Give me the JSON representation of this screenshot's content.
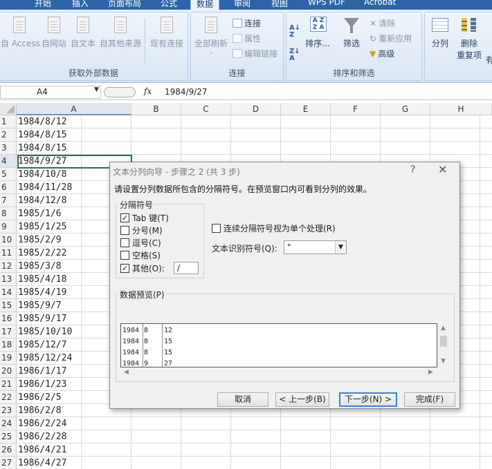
{
  "ribbon": {
    "tabs": [
      "开始",
      "插入",
      "页面布局",
      "公式",
      "数据",
      "审阅",
      "视图",
      "WPS PDF",
      "Acrobat"
    ],
    "active_tab": "数据",
    "get_external": {
      "label": "获取外部数据",
      "access": "自 Access",
      "web": "自网站",
      "text": "自文本",
      "other": "自其他来源",
      "existing": "现有连接"
    },
    "connections": {
      "label": "连接",
      "refresh_all": "全部刷新",
      "connect": "连接",
      "properties": "属性",
      "edit_links": "编辑链接"
    },
    "sort_filter": {
      "label": "排序和筛选",
      "sort": "排序...",
      "filter": "筛选",
      "clear": "清除",
      "reapply": "重新应用",
      "advanced": "高级"
    },
    "data_tools": {
      "split": "分列",
      "remove_dup": "删除",
      "remove_dup2": "重复项",
      "more": "有"
    }
  },
  "formula_bar": {
    "name_box": "A4",
    "fx": "fx",
    "formula": "1984/9/27"
  },
  "columns": [
    "A",
    "B",
    "C",
    "D",
    "E",
    "F",
    "G",
    "H"
  ],
  "rows": [
    {
      "num": "1",
      "a": "1984/8/12"
    },
    {
      "num": "2",
      "a": "1984/8/15"
    },
    {
      "num": "3",
      "a": "1984/8/15"
    },
    {
      "num": "4",
      "a": "1984/9/27"
    },
    {
      "num": "5",
      "a": "1984/10/8"
    },
    {
      "num": "6",
      "a": "1984/11/28"
    },
    {
      "num": "7",
      "a": "1984/12/8"
    },
    {
      "num": "8",
      "a": "1985/1/6"
    },
    {
      "num": "9",
      "a": "1985/1/25"
    },
    {
      "num": "10",
      "a": "1985/2/9"
    },
    {
      "num": "11",
      "a": "1985/2/22"
    },
    {
      "num": "12",
      "a": "1985/3/8"
    },
    {
      "num": "13",
      "a": "1985/4/18"
    },
    {
      "num": "14",
      "a": "1985/4/19"
    },
    {
      "num": "15",
      "a": "1985/9/7"
    },
    {
      "num": "16",
      "a": "1985/9/17"
    },
    {
      "num": "17",
      "a": "1985/10/10"
    },
    {
      "num": "18",
      "a": "1985/12/7"
    },
    {
      "num": "19",
      "a": "1985/12/24"
    },
    {
      "num": "20",
      "a": "1986/1/17"
    },
    {
      "num": "21",
      "a": "1986/1/23"
    },
    {
      "num": "22",
      "a": "1986/2/5"
    },
    {
      "num": "23",
      "a": "1986/2/8"
    },
    {
      "num": "24",
      "a": "1986/2/24"
    },
    {
      "num": "25",
      "a": "1986/2/28"
    },
    {
      "num": "26",
      "a": "1986/4/21"
    },
    {
      "num": "27",
      "a": "1986/4/27"
    }
  ],
  "dialog": {
    "title": "文本分列向导 - 步骤之 2 (共 3 步)",
    "help": "?",
    "close": "✕",
    "description": "请设置分列数据所包含的分隔符号。在预览窗口内可看到分列的效果。",
    "delimiters_legend": "分隔符号",
    "tab": {
      "label": "Tab 键(T)",
      "checked": true
    },
    "semicolon": {
      "label": "分号(M)",
      "checked": false
    },
    "comma": {
      "label": "逗号(C)",
      "checked": false
    },
    "space": {
      "label": "空格(S)",
      "checked": false
    },
    "other": {
      "label": "其他(O):",
      "checked": true,
      "value": "/"
    },
    "consecutive": {
      "label": "连续分隔符号视为单个处理(R)",
      "checked": false
    },
    "qualifier_label": "文本识别符号(Q):",
    "qualifier_value": "\"",
    "preview_legend": "数据预览(P)",
    "preview_rows": [
      [
        "1984",
        "8",
        "12"
      ],
      [
        "1984",
        "8",
        "15"
      ],
      [
        "1984",
        "8",
        "15"
      ],
      [
        "1984",
        "9",
        "27"
      ]
    ],
    "buttons": {
      "cancel": "取消",
      "back": "< 上一步(B)",
      "next": "下一步(N) >",
      "finish": "完成(F)"
    }
  }
}
